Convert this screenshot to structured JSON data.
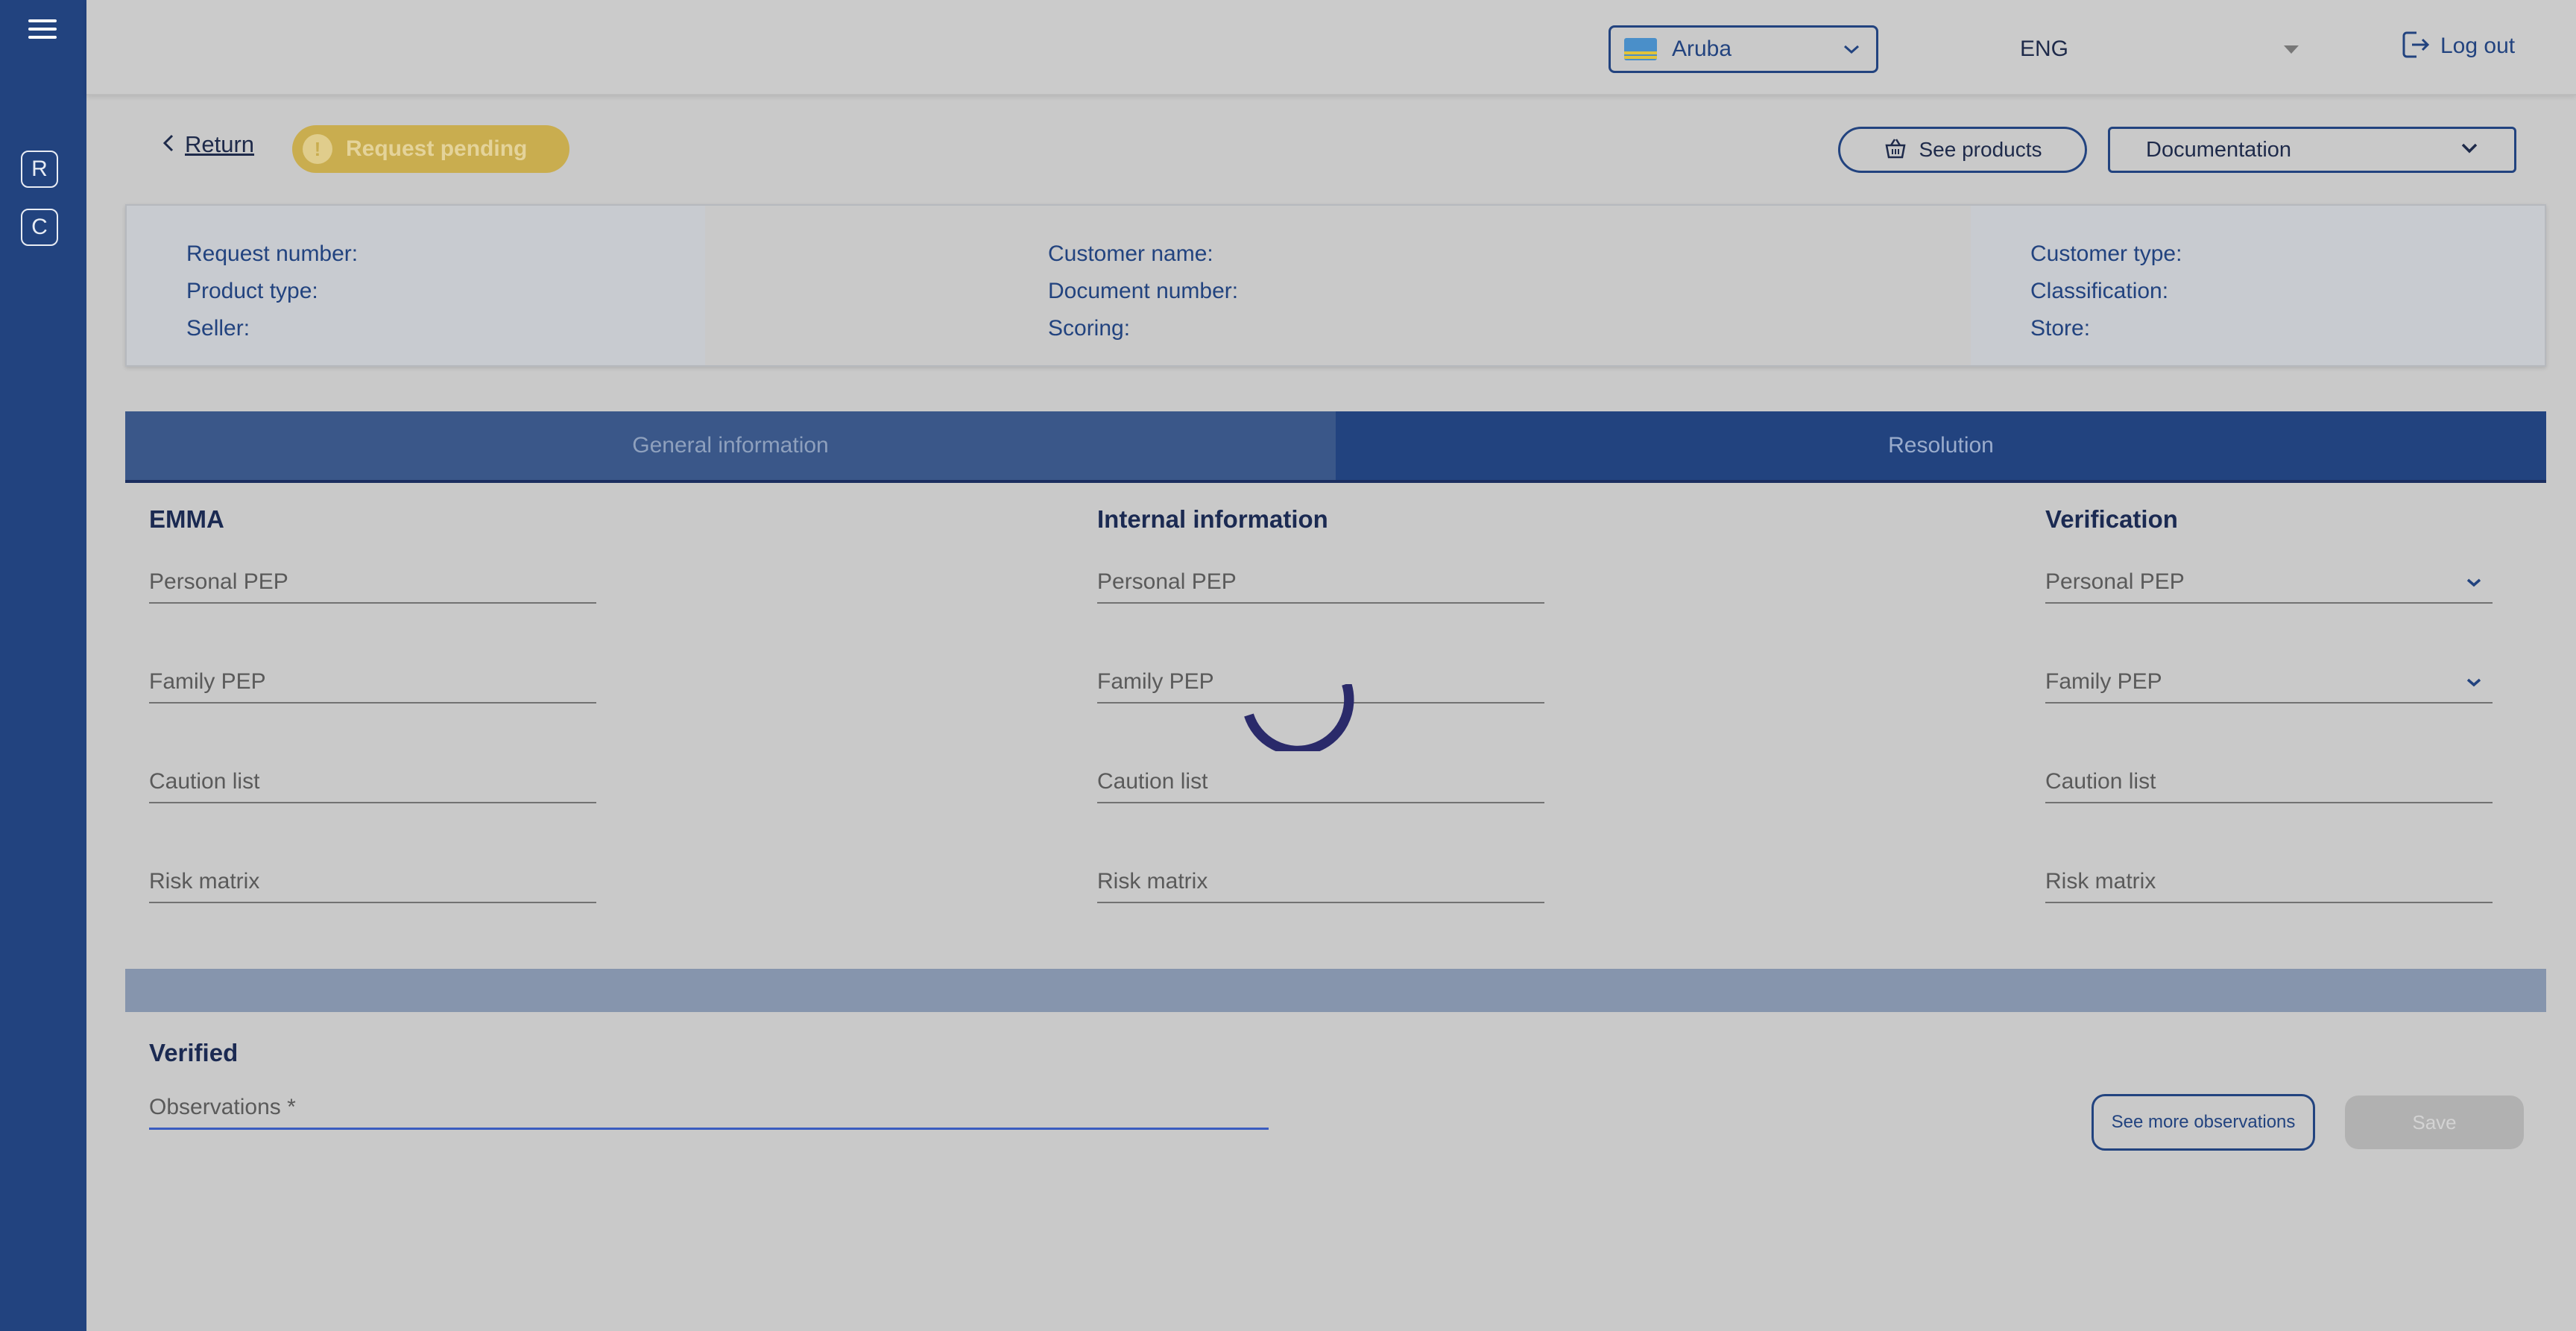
{
  "header": {
    "country": "Aruba",
    "language": "ENG",
    "logout_label": "Log out"
  },
  "sidebar": {
    "items": [
      {
        "label": "R"
      },
      {
        "label": "C"
      }
    ]
  },
  "actions": {
    "return_label": "Return",
    "status_label": "Request pending",
    "status_icon": "!",
    "see_products_label": "See products",
    "documentation_label": "Documentation"
  },
  "info": {
    "col1": [
      "Request number:",
      "Product type:",
      "Seller:"
    ],
    "col2": [
      "Customer name:",
      "Document number:",
      "Scoring:"
    ],
    "col3": [
      "Customer type:",
      "Classification:",
      "Store:"
    ]
  },
  "tabs": {
    "general": "General information",
    "resolution": "Resolution"
  },
  "columns": {
    "emma": {
      "title": "EMMA",
      "fields": [
        "Personal PEP",
        "Family PEP",
        "Caution list",
        "Risk matrix"
      ]
    },
    "internal": {
      "title": "Internal information",
      "fields": [
        "Personal PEP",
        "Family PEP",
        "Caution list",
        "Risk matrix"
      ]
    },
    "verification": {
      "title": "Verification",
      "fields": [
        "Personal PEP",
        "Family PEP",
        "Caution list",
        "Risk matrix"
      ]
    }
  },
  "verified": {
    "title": "Verified",
    "observations_label": "Observations *",
    "see_more_label": "See more observations",
    "save_label": "Save"
  },
  "colors": {
    "sidebar": "#22437f",
    "status_pill": "#c9ad4f",
    "tab_active": "#3a5789",
    "tab_inactive": "#22437f"
  }
}
